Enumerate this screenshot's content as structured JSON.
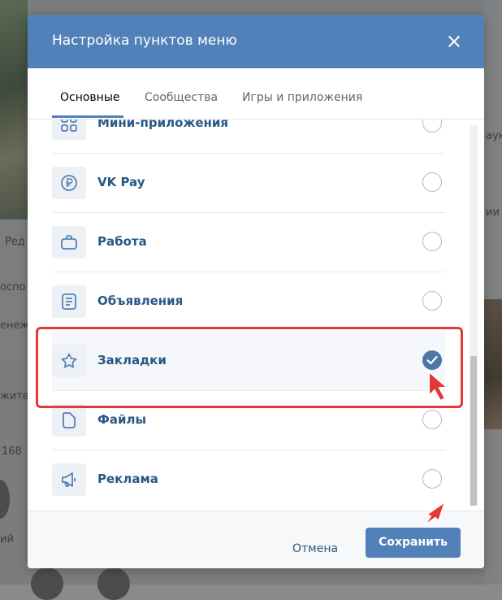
{
  "background": {
    "left_texts": [
      "Ред",
      "оспо",
      "енеж",
      "жите",
      "168",
      "ий"
    ],
    "right_texts": [
      "аую",
      "ии"
    ]
  },
  "modal": {
    "title": "Настройка пунктов меню",
    "close_icon": "close-icon"
  },
  "tabs": [
    {
      "label": "Основные",
      "active": true
    },
    {
      "label": "Сообщества",
      "active": false
    },
    {
      "label": "Игры и приложения",
      "active": false
    }
  ],
  "items": [
    {
      "label": "Мини-приложения",
      "icon": "apps-icon",
      "checked": false
    },
    {
      "label": "VK Pay",
      "icon": "ruble-icon",
      "checked": false
    },
    {
      "label": "Работа",
      "icon": "briefcase-icon",
      "checked": false
    },
    {
      "label": "Объявления",
      "icon": "ads-list-icon",
      "checked": false
    },
    {
      "label": "Закладки",
      "icon": "star-icon",
      "checked": true
    },
    {
      "label": "Файлы",
      "icon": "file-icon",
      "checked": false
    },
    {
      "label": "Реклама",
      "icon": "megaphone-icon",
      "checked": false
    }
  ],
  "footer": {
    "cancel_label": "Отмена",
    "save_label": "Сохранить"
  },
  "colors": {
    "header": "#5181b8",
    "link": "#2a5885",
    "highlight": "#e23a3a",
    "checked": "#4a76a8"
  }
}
